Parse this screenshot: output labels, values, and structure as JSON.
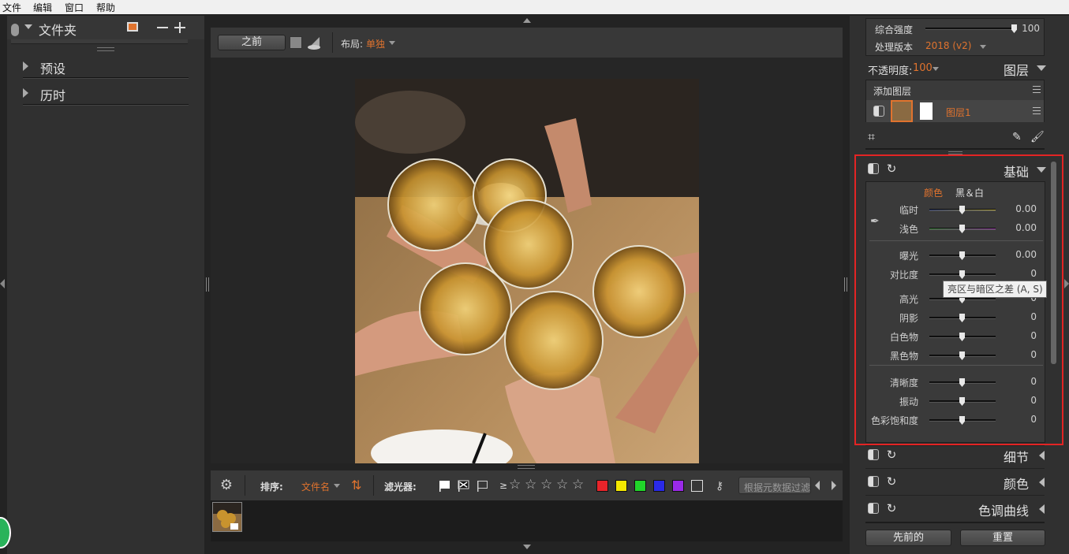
{
  "menu": [
    "文件",
    "编辑",
    "窗口",
    "帮助"
  ],
  "left": {
    "folder_label": "文件夹",
    "sections": [
      "预设",
      "历时"
    ]
  },
  "toolbar": {
    "before_button": "之前",
    "layout_label": "布局:",
    "layout_value": "单独"
  },
  "film": {
    "sort_label": "排序:",
    "sort_value": "文件名",
    "filter_label": "滤光器:",
    "rating_symbol": "≥",
    "stars": [
      "☆",
      "☆",
      "☆",
      "☆",
      "☆"
    ],
    "colors": [
      "#e8242a",
      "#f4e800",
      "#21d52a",
      "#2a2ae8",
      "#9a2ae8"
    ],
    "search_placeholder": "根据元数据过滤"
  },
  "right": {
    "overall_strength_label": "综合强度",
    "overall_strength_value": "100",
    "overall_strength_level": 1.0,
    "process_version_label": "处理版本",
    "process_version_value": "2018 (v2)",
    "opacity_label": "不透明度:",
    "opacity_value": "100",
    "layers_title": "图层",
    "add_layer": "添加图层",
    "layer_name": "图层1",
    "basic": {
      "title": "基础",
      "tab_color": "颜色",
      "tab_bw": "黑＆白",
      "tooltip": "亮区与暗区之差 (A, S)",
      "sliders": [
        {
          "label": "临时",
          "value": "0.00"
        },
        {
          "label": "浅色",
          "value": "0.00"
        },
        {
          "label": "曝光",
          "value": "0.00"
        },
        {
          "label": "对比度",
          "value": "0"
        },
        {
          "label": "高光",
          "value": "0"
        },
        {
          "label": "阴影",
          "value": "0"
        },
        {
          "label": "白色物",
          "value": "0"
        },
        {
          "label": "黑色物",
          "value": "0"
        },
        {
          "label": "清晰度",
          "value": "0"
        },
        {
          "label": "振动",
          "value": "0"
        },
        {
          "label": "色彩饱和度",
          "value": "0"
        }
      ]
    },
    "collapsed_panels": [
      "细节",
      "颜色",
      "色调曲线"
    ],
    "prev_button": "先前的",
    "reset_button": "重置"
  }
}
